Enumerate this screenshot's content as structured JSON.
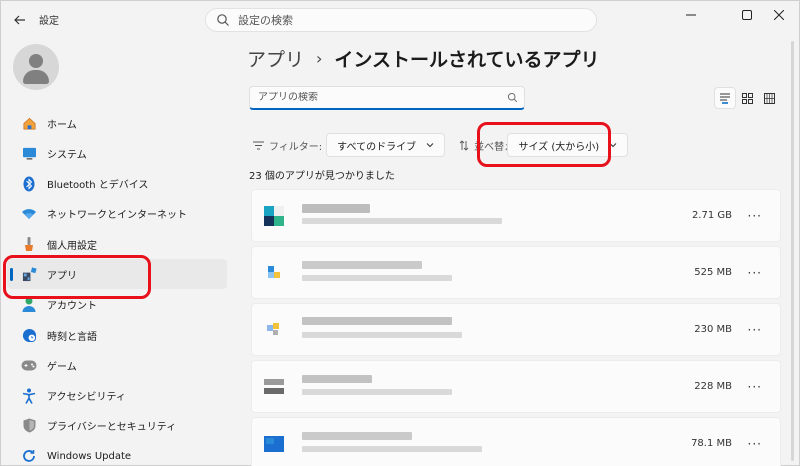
{
  "window": {
    "title": "設定",
    "back_icon": "back-arrow-icon",
    "controls": [
      "minimize-icon",
      "maximize-icon",
      "close-icon"
    ]
  },
  "search": {
    "placeholder": "設定の検索"
  },
  "sidebar": {
    "items": [
      {
        "label": "ホーム",
        "icon": "home-icon",
        "active": false
      },
      {
        "label": "システム",
        "icon": "system-icon",
        "active": false
      },
      {
        "label": "Bluetooth とデバイス",
        "icon": "bluetooth-icon",
        "active": false
      },
      {
        "label": "ネットワークとインターネット",
        "icon": "wifi-icon",
        "active": false
      },
      {
        "label": "個人用設定",
        "icon": "brush-icon",
        "active": false
      },
      {
        "label": "アプリ",
        "icon": "apps-icon",
        "active": true
      },
      {
        "label": "アカウント",
        "icon": "account-icon",
        "active": false
      },
      {
        "label": "時刻と言語",
        "icon": "globe-clock-icon",
        "active": false
      },
      {
        "label": "ゲーム",
        "icon": "gamepad-icon",
        "active": false
      },
      {
        "label": "アクセシビリティ",
        "icon": "accessibility-icon",
        "active": false
      },
      {
        "label": "プライバシーとセキュリティ",
        "icon": "shield-icon",
        "active": false
      },
      {
        "label": "Windows Update",
        "icon": "update-icon",
        "active": false
      }
    ]
  },
  "main": {
    "breadcrumb": {
      "parent": "アプリ",
      "separator": "›",
      "current": "インストールされているアプリ"
    },
    "app_search": {
      "placeholder": "アプリの検索"
    },
    "view_modes": [
      "list-view-icon",
      "grid-view-icon",
      "tile-view-icon"
    ],
    "filter": {
      "label": "フィルター:",
      "value": "すべてのドライブ"
    },
    "sort": {
      "label": "並べ替え:",
      "value": "サイズ (大から小)"
    },
    "count_text": "23 個のアプリが見つかりました",
    "apps": [
      {
        "size": "2.71 GB",
        "more": "···"
      },
      {
        "size": "525 MB",
        "more": "···"
      },
      {
        "size": "230 MB",
        "more": "···"
      },
      {
        "size": "228 MB",
        "more": "···"
      },
      {
        "size": "78.1 MB",
        "more": "···"
      }
    ]
  },
  "colors": {
    "accent": "#0067c0",
    "highlight": "#e8101a",
    "background": "#f3f3f3"
  }
}
